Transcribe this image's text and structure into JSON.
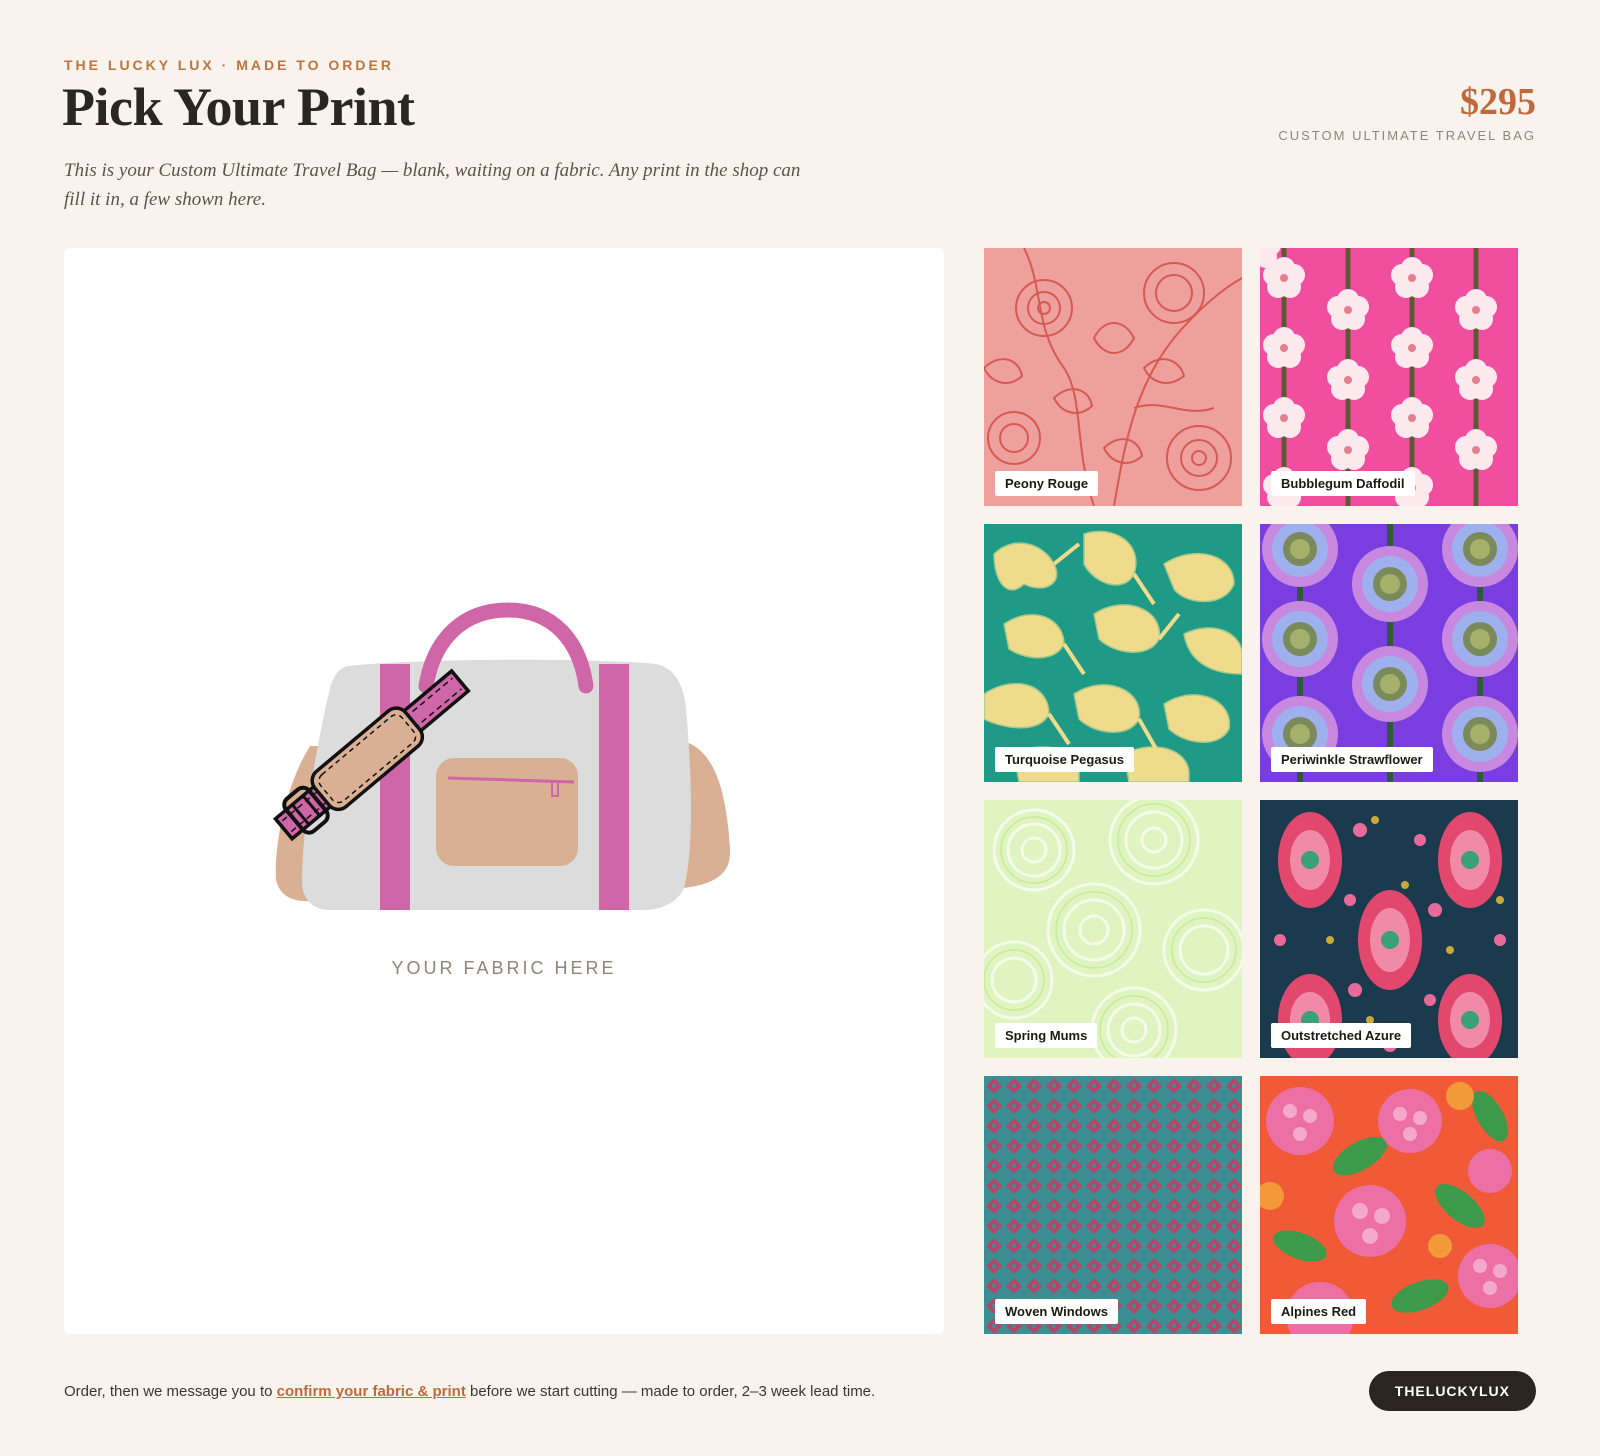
{
  "header": {
    "eyebrow": "THE LUCKY LUX · MADE TO ORDER",
    "title": "Pick Your Print",
    "subtitle": "This is your Custom Ultimate Travel Bag — blank, waiting on a fabric. Any print in the shop can fill it in, a few shown here."
  },
  "price": {
    "amount": "$295",
    "label": "CUSTOM ULTIMATE TRAVEL BAG"
  },
  "preview": {
    "placeholder": "YOUR FABRIC HERE",
    "colors": {
      "body": "#dcdcdc",
      "strap": "#cf66a8",
      "accent": "#d9b094"
    }
  },
  "prints": [
    {
      "name": "Peony Rouge",
      "icon": "peony-rouge-swatch"
    },
    {
      "name": "Bubblegum Daffodil",
      "icon": "bubblegum-daffodil-swatch"
    },
    {
      "name": "Turquoise Pegasus",
      "icon": "turquoise-pegasus-swatch"
    },
    {
      "name": "Periwinkle Strawflower",
      "icon": "periwinkle-strawflower-swatch"
    },
    {
      "name": "Spring Mums",
      "icon": "spring-mums-swatch"
    },
    {
      "name": "Outstretched Azure",
      "icon": "outstretched-azure-swatch"
    },
    {
      "name": "Woven Windows",
      "icon": "woven-windows-swatch"
    },
    {
      "name": "Alpines Red",
      "icon": "alpines-red-swatch"
    }
  ],
  "footer": {
    "before": "Order, then we message you to ",
    "link": "confirm your fabric & print",
    "after": " before we start cutting — made to order, 2–3 week lead time.",
    "handle": "THELUCKYLUX"
  }
}
